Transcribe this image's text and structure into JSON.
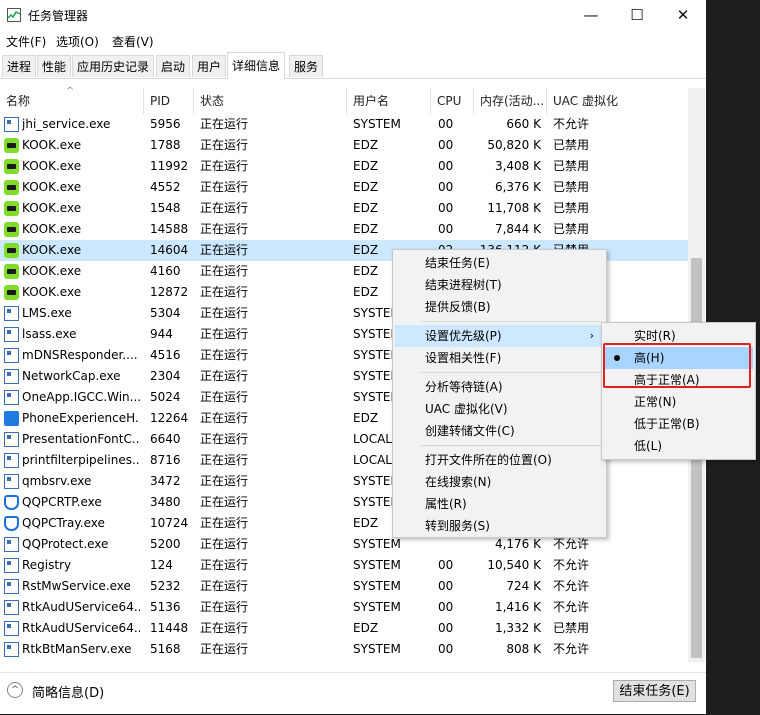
{
  "window": {
    "title": "任务管理器",
    "minimize": "—",
    "maximize": "☐",
    "close": "✕"
  },
  "menu": [
    "文件(F)",
    "选项(O)",
    "查看(V)"
  ],
  "tabs": [
    "进程",
    "性能",
    "应用历史记录",
    "启动",
    "用户",
    "详细信息",
    "服务"
  ],
  "columns": [
    "名称",
    "PID",
    "状态",
    "用户名",
    "CPU",
    "内存(活动...",
    "UAC 虚拟化"
  ],
  "sort_indicator": "^",
  "rows": [
    {
      "icon": "service-window-icon",
      "name": "jhi_service.exe",
      "pid": "5956",
      "status": "正在运行",
      "user": "SYSTEM",
      "cpu": "00",
      "mem": "660 K",
      "uac": "不允许"
    },
    {
      "icon": "kook-icon",
      "name": "KOOK.exe",
      "pid": "1788",
      "status": "正在运行",
      "user": "EDZ",
      "cpu": "00",
      "mem": "50,820 K",
      "uac": "已禁用"
    },
    {
      "icon": "kook-icon",
      "name": "KOOK.exe",
      "pid": "11992",
      "status": "正在运行",
      "user": "EDZ",
      "cpu": "00",
      "mem": "3,408 K",
      "uac": "已禁用"
    },
    {
      "icon": "kook-icon",
      "name": "KOOK.exe",
      "pid": "4552",
      "status": "正在运行",
      "user": "EDZ",
      "cpu": "00",
      "mem": "6,376 K",
      "uac": "已禁用"
    },
    {
      "icon": "kook-icon",
      "name": "KOOK.exe",
      "pid": "1548",
      "status": "正在运行",
      "user": "EDZ",
      "cpu": "00",
      "mem": "11,708 K",
      "uac": "已禁用"
    },
    {
      "icon": "kook-icon",
      "name": "KOOK.exe",
      "pid": "14588",
      "status": "正在运行",
      "user": "EDZ",
      "cpu": "00",
      "mem": "7,844 K",
      "uac": "已禁用"
    },
    {
      "icon": "kook-icon",
      "name": "KOOK.exe",
      "pid": "14604",
      "status": "正在运行",
      "user": "EDZ",
      "cpu": "02",
      "mem": "136,112 K",
      "uac": "已禁用",
      "selected": true
    },
    {
      "icon": "kook-icon",
      "name": "KOOK.exe",
      "pid": "4160",
      "status": "正在运行",
      "user": "EDZ",
      "cpu": "",
      "mem": "",
      "uac": ""
    },
    {
      "icon": "kook-icon",
      "name": "KOOK.exe",
      "pid": "12872",
      "status": "正在运行",
      "user": "EDZ",
      "cpu": "",
      "mem": "",
      "uac": ""
    },
    {
      "icon": "service-window-icon",
      "name": "LMS.exe",
      "pid": "5304",
      "status": "正在运行",
      "user": "SYSTEM",
      "cpu": "",
      "mem": "",
      "uac": ""
    },
    {
      "icon": "service-window-icon",
      "name": "lsass.exe",
      "pid": "944",
      "status": "正在运行",
      "user": "SYSTEM",
      "cpu": "",
      "mem": "",
      "uac": ""
    },
    {
      "icon": "service-window-icon",
      "name": "mDNSResponder....",
      "pid": "4516",
      "status": "正在运行",
      "user": "SYSTEM",
      "cpu": "",
      "mem": "",
      "uac": ""
    },
    {
      "icon": "service-window-icon",
      "name": "NetworkCap.exe",
      "pid": "2304",
      "status": "正在运行",
      "user": "SYSTEM",
      "cpu": "",
      "mem": "",
      "uac": ""
    },
    {
      "icon": "service-window-icon",
      "name": "OneApp.IGCC.Win...",
      "pid": "5024",
      "status": "正在运行",
      "user": "SYSTEM",
      "cpu": "",
      "mem": "",
      "uac": ""
    },
    {
      "icon": "phone-experience-icon",
      "name": "PhoneExperienceH...",
      "pid": "12264",
      "status": "正在运行",
      "user": "EDZ",
      "cpu": "",
      "mem": "",
      "uac": ""
    },
    {
      "icon": "service-window-icon",
      "name": "PresentationFontC...",
      "pid": "6640",
      "status": "正在运行",
      "user": "LOCAL",
      "cpu": "",
      "mem": "",
      "uac": ""
    },
    {
      "icon": "service-window-icon",
      "name": "printfilterpipelines...",
      "pid": "8716",
      "status": "正在运行",
      "user": "LOCAL",
      "cpu": "",
      "mem": "",
      "uac": ""
    },
    {
      "icon": "service-window-icon",
      "name": "qmbsrv.exe",
      "pid": "3472",
      "status": "正在运行",
      "user": "SYSTEM",
      "cpu": "",
      "mem": "",
      "uac": ""
    },
    {
      "icon": "qq-shield-icon",
      "name": "QQPCRTP.exe",
      "pid": "3480",
      "status": "正在运行",
      "user": "SYSTEM",
      "cpu": "",
      "mem": "",
      "uac": ""
    },
    {
      "icon": "qq-shield-icon",
      "name": "QQPCTray.exe",
      "pid": "10724",
      "status": "正在运行",
      "user": "EDZ",
      "cpu": "",
      "mem": "",
      "uac": ""
    },
    {
      "icon": "service-window-icon",
      "name": "QQProtect.exe",
      "pid": "5200",
      "status": "正在运行",
      "user": "SYSTEM",
      "cpu": "",
      "mem": "4,176 K",
      "uac": "不允许"
    },
    {
      "icon": "service-window-icon",
      "name": "Registry",
      "pid": "124",
      "status": "正在运行",
      "user": "SYSTEM",
      "cpu": "00",
      "mem": "10,540 K",
      "uac": "不允许"
    },
    {
      "icon": "service-window-icon",
      "name": "RstMwService.exe",
      "pid": "5232",
      "status": "正在运行",
      "user": "SYSTEM",
      "cpu": "00",
      "mem": "724 K",
      "uac": "不允许"
    },
    {
      "icon": "service-window-icon",
      "name": "RtkAudUService64....",
      "pid": "5136",
      "status": "正在运行",
      "user": "SYSTEM",
      "cpu": "00",
      "mem": "1,416 K",
      "uac": "不允许"
    },
    {
      "icon": "service-window-icon",
      "name": "RtkAudUService64....",
      "pid": "11448",
      "status": "正在运行",
      "user": "EDZ",
      "cpu": "00",
      "mem": "1,332 K",
      "uac": "已禁用"
    },
    {
      "icon": "service-window-icon",
      "name": "RtkBtManServ.exe",
      "pid": "5168",
      "status": "正在运行",
      "user": "SYSTEM",
      "cpu": "00",
      "mem": "808 K",
      "uac": "不允许"
    }
  ],
  "context_menu": {
    "items": [
      {
        "label": "结束任务(E)"
      },
      {
        "label": "结束进程树(T)"
      },
      {
        "label": "提供反馈(B)"
      },
      {
        "sep": true
      },
      {
        "label": "设置优先级(P)",
        "submenu": true,
        "highlighted": true
      },
      {
        "label": "设置相关性(F)"
      },
      {
        "sep": true
      },
      {
        "label": "分析等待链(A)"
      },
      {
        "label": "UAC 虚拟化(V)"
      },
      {
        "label": "创建转储文件(C)"
      },
      {
        "sep": true
      },
      {
        "label": "打开文件所在的位置(O)"
      },
      {
        "label": "在线搜索(N)"
      },
      {
        "label": "属性(R)"
      },
      {
        "label": "转到服务(S)"
      }
    ],
    "submenu_arrow": "›"
  },
  "priority_submenu": {
    "items": [
      {
        "label": "实时(R)"
      },
      {
        "label": "高(H)",
        "checked": true,
        "highlighted": true
      },
      {
        "label": "高于正常(A)"
      },
      {
        "label": "正常(N)"
      },
      {
        "label": "低于正常(B)"
      },
      {
        "label": "低(L)"
      }
    ]
  },
  "footer": {
    "collapse_glyph": "^",
    "fewer_details": "简略信息(D)",
    "end_task": "结束任务(E)"
  },
  "colors": {
    "selection": "#cce8ff",
    "menu_highlight": "#cde8ff",
    "annotation_box": "#e02020",
    "kook_green": "#7fdc2a"
  }
}
